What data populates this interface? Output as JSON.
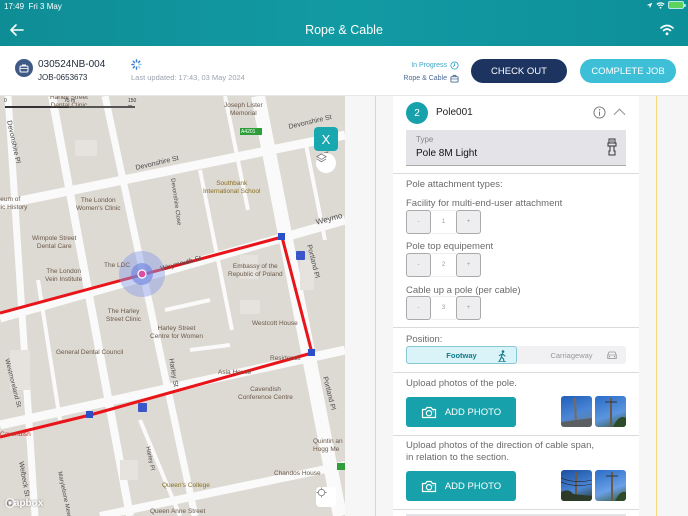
{
  "status_bar": {
    "time": "17:49",
    "date": "Fri 3 May",
    "icons": [
      "location-arrow-icon",
      "wifi-icon",
      "battery-charging-icon"
    ]
  },
  "topbar": {
    "title": "Rope & Cable",
    "back_icon": "arrow-left-icon",
    "right_icon": "wifi-icon"
  },
  "header": {
    "job_number": "030524NB-004",
    "job_id": "JOB-0653673",
    "last_updated": "Last updated: 17:43, 03 May 2024",
    "status": "In Progress",
    "job_type": "Rope & Cable",
    "checkout_label": "CHECK OUT",
    "complete_label": "COMPLETE JOB"
  },
  "map": {
    "scale_labels": [
      "0",
      "75 m",
      "150 m"
    ],
    "labels": {
      "harley_dental": "Harley Street\nDental Clinic",
      "joseph_lister": "Joseph Lister\nMemorial",
      "a4201": "A4201",
      "devonshire_st_1": "Devonshire St",
      "devonshire_st_2": "Devonshire St",
      "devonshire_pl": "Devonshire Pl",
      "museum": "Museum of\nMedic History",
      "london_womens": "The London\nWomen's Clinic",
      "devonshire_close": "Devonshire Close",
      "southbank": "Southbank\nInternational School",
      "wimpole_dental": "Wimpole Street\nDental Care",
      "the_ldc": "The LDC",
      "weymouth_st": "Weymouth St",
      "weymo": "Weymo",
      "london_vein": "The London\nVein Institute",
      "embassy": "Embassy of the\nRepublic of Poland",
      "portland_pl": "Portland Pl",
      "harley_clinic": "The Harley\nStreet Clinic",
      "harley_women": "Harley Street\nCentre for Women",
      "westcott": "Westcott House",
      "gdc": "General Dental Council",
      "harley_st": "Harley St",
      "residence": "Residence",
      "asia_house": "Asia House",
      "westmoreland": "Westmoreland St",
      "cavendish_conf": "Cavendish\nConference Centre",
      "cavendish": "Cavendish",
      "welbeck": "Welbeck St",
      "marylebone_mews": "Marylebone Mews",
      "harley_pl": "Harley Pl",
      "quintin": "Quintin an\nHogg Me",
      "chandos": "Chandos House",
      "queens_college": "Queen's College",
      "queen_anne": "Queen Anne Street",
      "mews": "Mews",
      "portland_pl_2": "Portland Pl"
    },
    "x_button": "X",
    "attribution": "mapbox"
  },
  "pole": {
    "number": "2",
    "name": "Pole001",
    "type_label": "Type",
    "type_value": "Pole 8M Light",
    "attachment_title": "Pole attachment types:",
    "attachments": [
      {
        "label": "Facility for multi-end-user attachment",
        "value": "1",
        "minus": "-",
        "plus": "+"
      },
      {
        "label": "Pole top equipement",
        "value": "2",
        "minus": "-",
        "plus": "+"
      },
      {
        "label": "Cable up a pole (per cable)",
        "value": "3",
        "minus": "-",
        "plus": "+"
      }
    ],
    "position_label": "Position:",
    "position_options": [
      {
        "label": "Footway",
        "selected": true,
        "icon": "pedestrian-icon"
      },
      {
        "label": "Carriageway",
        "selected": false,
        "icon": "car-icon"
      }
    ],
    "upload_pole_label": "Upload photos of the pole.",
    "upload_span_label": "Upload photos of the direction of cable span,\nin relation to the section.",
    "add_photo_label": "ADD PHOTO"
  },
  "colors": {
    "teal": "#17a2ab",
    "navy": "#1d3461",
    "light_blue": "#3cbfd7",
    "route_red": "#e8141a",
    "marker_blue": "#2b4fc9"
  }
}
